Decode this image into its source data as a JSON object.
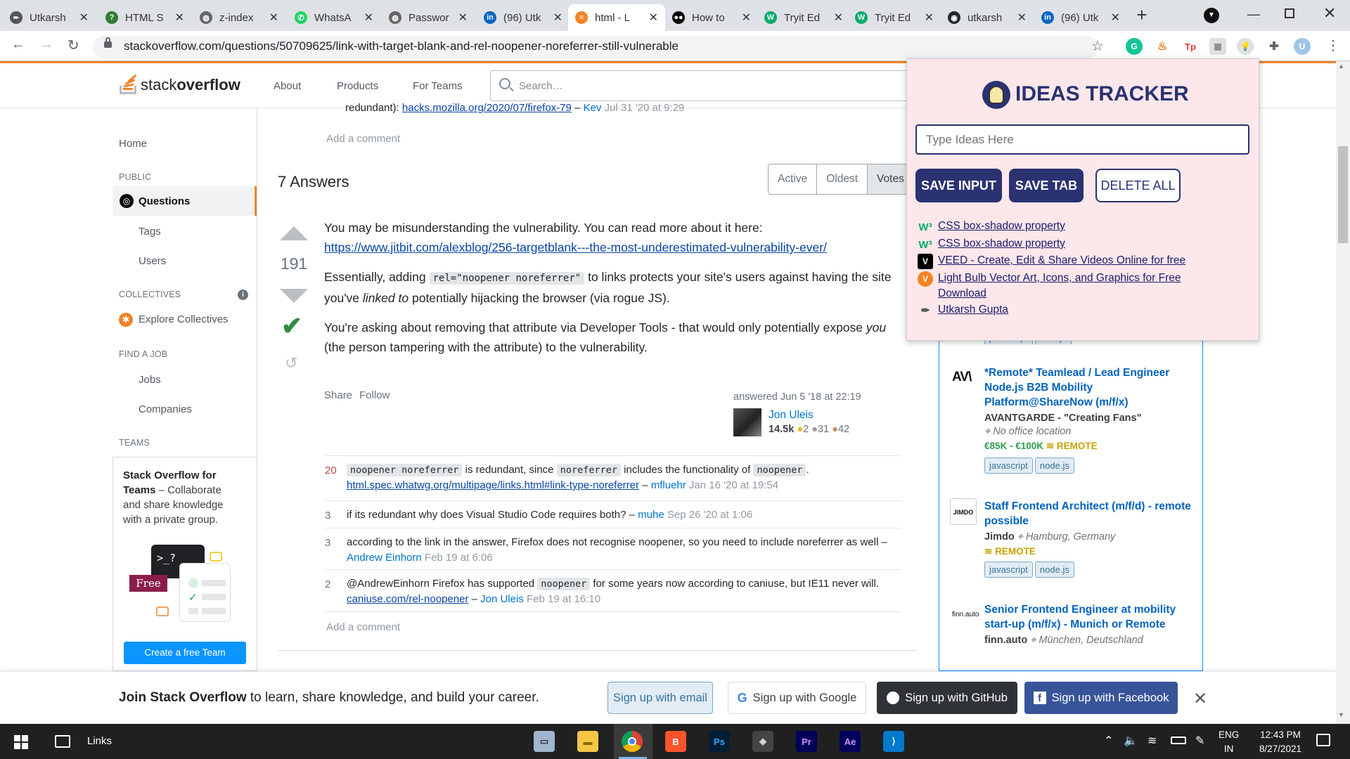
{
  "browser": {
    "tabs": [
      {
        "title": "Utkarsh",
        "icon": "pen-icon",
        "color": "#555555"
      },
      {
        "title": "HTML S",
        "icon": "question-icon",
        "color": "#2f7d32"
      },
      {
        "title": "z-index",
        "icon": "globe-icon",
        "color": "#666666"
      },
      {
        "title": "WhatsA",
        "icon": "whatsapp-icon",
        "color": "#25d366"
      },
      {
        "title": "Passwor",
        "icon": "globe-icon",
        "color": "#666666"
      },
      {
        "title": "(96) Utk",
        "icon": "linkedin-icon",
        "color": "#0a66c2"
      },
      {
        "title": "html - L",
        "icon": "stackoverflow-icon",
        "color": "#f48225"
      },
      {
        "title": "How to",
        "icon": "medium-icon",
        "color": "#000000"
      },
      {
        "title": "Tryit Ed",
        "icon": "w3schools-icon",
        "color": "#04aa6d"
      },
      {
        "title": "Tryit Ed",
        "icon": "w3schools-icon",
        "color": "#04aa6d"
      },
      {
        "title": "utkarsh",
        "icon": "github-icon",
        "color": "#24292e"
      },
      {
        "title": "(96) Utk",
        "icon": "linkedin-icon",
        "color": "#0a66c2"
      }
    ],
    "url": "stackoverflow.com/questions/50709625/link-with-target-blank-and-rel-noopener-noreferrer-still-vulnerable"
  },
  "so_header": {
    "logo_text_a": "stack",
    "logo_text_b": "overflow",
    "nav": [
      "About",
      "Products",
      "For Teams"
    ],
    "search_placeholder": "Search…"
  },
  "left_nav": {
    "home": "Home",
    "public": "PUBLIC",
    "questions": "Questions",
    "tags": "Tags",
    "users": "Users",
    "collectives": "COLLECTIVES",
    "explore_collectives": "Explore Collectives",
    "find_a_job": "FIND A JOB",
    "jobs": "Jobs",
    "companies": "Companies",
    "teams": "TEAMS",
    "teams_title": "Stack Overflow for Teams",
    "teams_desc": "– Collaborate and share knowledge with a private group.",
    "free_badge": "Free",
    "create_team": "Create a free Team"
  },
  "question_comment": {
    "text": "redundant):",
    "link": "hacks.mozilla.org/2020/07/firefox-79",
    "user": "Kev",
    "date": "Jul 31 '20 at 9:29",
    "add_comment": "Add a comment"
  },
  "answers": {
    "count_label": "7 Answers",
    "sort": [
      "Active",
      "Oldest",
      "Votes"
    ]
  },
  "answer": {
    "votes": "191",
    "p1": "You may be misunderstanding the vulnerability. You can read more about it here:",
    "p1_link": "https://www.jitbit.com/alexblog/256-targetblank---the-most-underestimated-vulnerability-ever/",
    "p2_a": "Essentially, adding",
    "p2_code": "rel=\"noopener noreferrer\"",
    "p2_b": "to links protects your site's users against having the site you've",
    "p2_em": "linked to",
    "p2_c": "potentially hijacking the browser (via rogue JS).",
    "p3_a": "You're asking about removing that attribute via Developer Tools - that would only potentially expose",
    "p3_em": "you",
    "p3_b": "(the person tampering with the attribute) to the vulnerability.",
    "share": "Share",
    "follow": "Follow",
    "answered": "answered Jun 5 '18 at 22:19",
    "author": "Jon Uleis",
    "rep": "14.5k",
    "gold": "2",
    "silver": "31",
    "bronze": "42"
  },
  "comments": [
    {
      "score": "20",
      "code1": "noopener noreferrer",
      "t1": "is redundant, since",
      "code2": "noreferrer",
      "t2": "includes the functionality of",
      "code3": "noopener",
      "t3": ".",
      "link": "html.spec.whatwg.org/multipage/links.html#link-type-noreferrer",
      "user": "mfluehr",
      "date": "Jan 16 '20 at 19:54"
    },
    {
      "score": "3",
      "text": "if its redundant why does Visual Studio Code requires both?",
      "user": "muhe",
      "date": "Sep 26 '20 at 1:06"
    },
    {
      "score": "3",
      "text": "according to the link in the answer, Firefox does not recognise noopener, so you need to include noreferrer as well",
      "user": "Andrew Einhorn",
      "date": "Feb 19 at 6:06"
    },
    {
      "score": "2",
      "t1": "@AndrewEinhorn Firefox has supported",
      "code1": "noopener",
      "t2": "for some years now according to caniuse, but IE11 never will.",
      "link": "caniuse.com/rel-noopener",
      "user": "Jon Uleis",
      "date": "Feb 19 at 16:10"
    }
  ],
  "add_comment_2": "Add a comment",
  "jobs": [
    {
      "title": "*Remote* Teamlead / Lead Engineer Node.js B2B Mobility Platform@ShareNow (m/f/x)",
      "logo": "AV\\",
      "company": "AVANTGARDE - \"Creating Fans\"",
      "location": "No office location",
      "salary": "€85K - €100K",
      "remote": "REMOTE",
      "tags": [
        "javascript",
        "node.js"
      ]
    },
    {
      "title": "Staff Frontend Architect (m/f/d) - remote possible",
      "logo": "JIMDO",
      "company": "Jimdo",
      "location": "Hamburg, Germany",
      "remote": "REMOTE",
      "tags": [
        "javascript",
        "node.js"
      ]
    },
    {
      "title": "Senior Frontend Engineer at mobility start-up (m/f/x) - Munich or Remote",
      "logo": "finn.auto",
      "company": "finn.auto",
      "location": "München, Deutschland"
    }
  ],
  "job_tags_top": [
    "javascript",
    "next.js"
  ],
  "ideas_tracker": {
    "title": "IDEAS TRACKER",
    "input_placeholder": "Type Ideas Here",
    "save_input": "SAVE INPUT",
    "save_tab": "SAVE TAB",
    "delete_all": "DELETE ALL",
    "links": [
      {
        "text": "CSS box-shadow property",
        "icon": "w3schools-icon"
      },
      {
        "text": "CSS box-shadow property",
        "icon": "w3schools-icon"
      },
      {
        "text": "VEED - Create, Edit & Share Videos Online for free",
        "icon": "veed-icon"
      },
      {
        "text": "Light Bulb Vector Art, Icons, and Graphics for Free Download",
        "icon": "vecteezy-icon"
      },
      {
        "text": "Utkarsh Gupta",
        "icon": "pen-icon"
      }
    ]
  },
  "banner": {
    "join_bold": "Join Stack Overflow",
    "join_rest": "to learn, share knowledge, and build your career.",
    "email": "Sign up with email",
    "google": "Sign up with Google",
    "github": "Sign up with GitHub",
    "facebook": "Sign up with Facebook"
  },
  "taskbar": {
    "links": "Links",
    "lang1": "ENG",
    "lang2": "IN",
    "time": "12:43 PM",
    "date": "8/27/2021"
  },
  "colors": {
    "so_orange": "#f48225",
    "popup_bg": "#fde7ea",
    "popup_btn": "#2a3272",
    "so_blue": "#0a95ff"
  }
}
